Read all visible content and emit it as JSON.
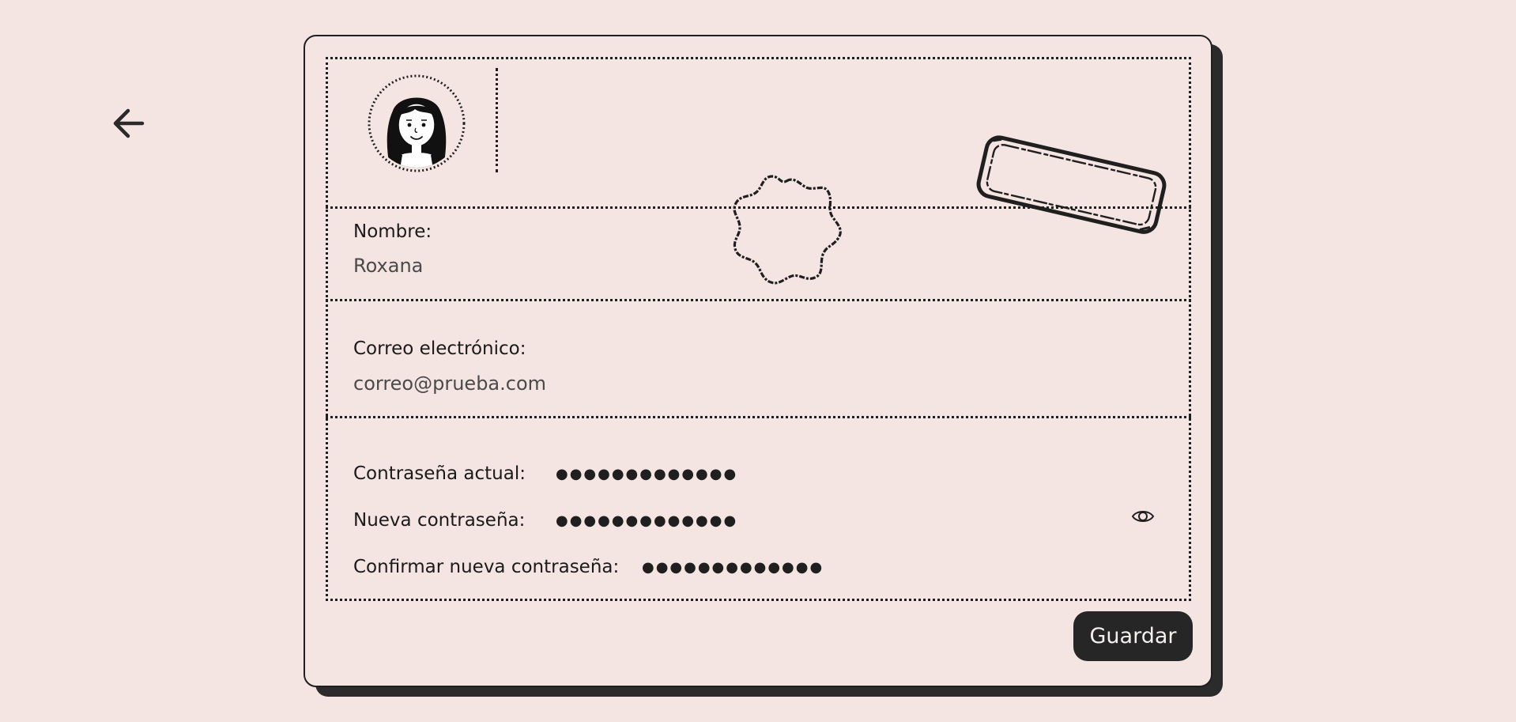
{
  "nav": {
    "back_icon": "arrow-left-icon"
  },
  "profile": {
    "avatar_icon": "woman-avatar-icon",
    "fields": {
      "name_label": "Nombre:",
      "name_value": "Roxana",
      "email_label": "Correo electrónico:",
      "email_value": "correo@prueba.com",
      "current_password_label": "Contraseña actual:",
      "current_password_value": "●●●●●●●●●●●●●",
      "new_password_label": "Nueva contraseña:",
      "new_password_value": "●●●●●●●●●●●●●",
      "confirm_password_label": "Confirmar nueva contraseña:",
      "confirm_password_value": "●●●●●●●●●●●●●"
    },
    "eye_icon": "eye-icon"
  },
  "actions": {
    "save_label": "Guardar"
  },
  "colors": {
    "background": "#f5e5e2",
    "ink": "#1f1f1f",
    "button": "#262626",
    "button_text": "#f4f0ef"
  }
}
